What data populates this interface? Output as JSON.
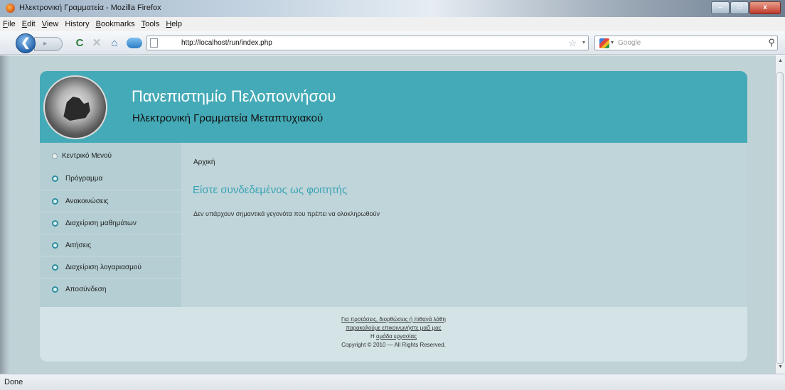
{
  "window": {
    "title": "Ηλεκτρονική Γραμματεία - Mozilla Firefox",
    "controls": {
      "minimize": "–",
      "maximize": "□",
      "close": "x"
    }
  },
  "menubar": {
    "items": [
      {
        "label": "File",
        "mnemonic": "F",
        "rest": "ile"
      },
      {
        "label": "Edit",
        "mnemonic": "E",
        "rest": "dit"
      },
      {
        "label": "View",
        "mnemonic": "V",
        "rest": "iew"
      },
      {
        "label": "History",
        "mnemonic": "",
        "rest": "History"
      },
      {
        "label": "Bookmarks",
        "mnemonic": "B",
        "rest": "ookmarks"
      },
      {
        "label": "Tools",
        "mnemonic": "T",
        "rest": "ools"
      },
      {
        "label": "Help",
        "mnemonic": "H",
        "rest": "elp"
      }
    ]
  },
  "navbar": {
    "back": "❮",
    "forward": "▸",
    "reload": "C",
    "stop": "✕",
    "home": "⌂",
    "url": "http://localhost/run/index.php",
    "star": "☆",
    "url_dropdown": "▾",
    "search_placeholder": "Google",
    "search_dropdown": "▾",
    "search_icon_glyph": "⚲"
  },
  "page": {
    "title": "Πανεπιστημίο Πελοποννήσου",
    "subtitle": "Ηλεκτρονική Γραμματεία Μεταπτυχιακού",
    "sidebar": {
      "menu_title": "Κεντρικό Μενού",
      "items": [
        {
          "label": "Πρόγραμμα"
        },
        {
          "label": "Ανακοινώσεις"
        },
        {
          "label": "Διαχείριση μαθημάτων"
        },
        {
          "label": "Αιτήσεις"
        },
        {
          "label": "Διαχείριση λογαριασμού"
        },
        {
          "label": "Αποσύνδεση"
        }
      ]
    },
    "main": {
      "breadcrumb": "Αρχική",
      "heading": "Είστε συνδεδεμένος ως φοιτητής",
      "text": "Δεν υπάρχουν σημαντικά γεγονότα που πρέπει να ολοκληρωθούν"
    },
    "footer": {
      "line1": "Για προτάσεις, διορθώσεις ή πιθανά λάθη",
      "line2": "παρακαλούμε επικοινωνήστε μαζί μας",
      "line3_prefix": "Η",
      "line3_link": "ομάδα εργασίας",
      "copyright": "Copyright © 2010 — All Rights Reserved."
    }
  },
  "statusbar": {
    "text": "Done"
  },
  "colors": {
    "header": "#45aab7",
    "heading": "#3aa3b4",
    "sidebar": "#b4ced3",
    "main": "#bfd5da",
    "footer": "#d3e3e6"
  }
}
